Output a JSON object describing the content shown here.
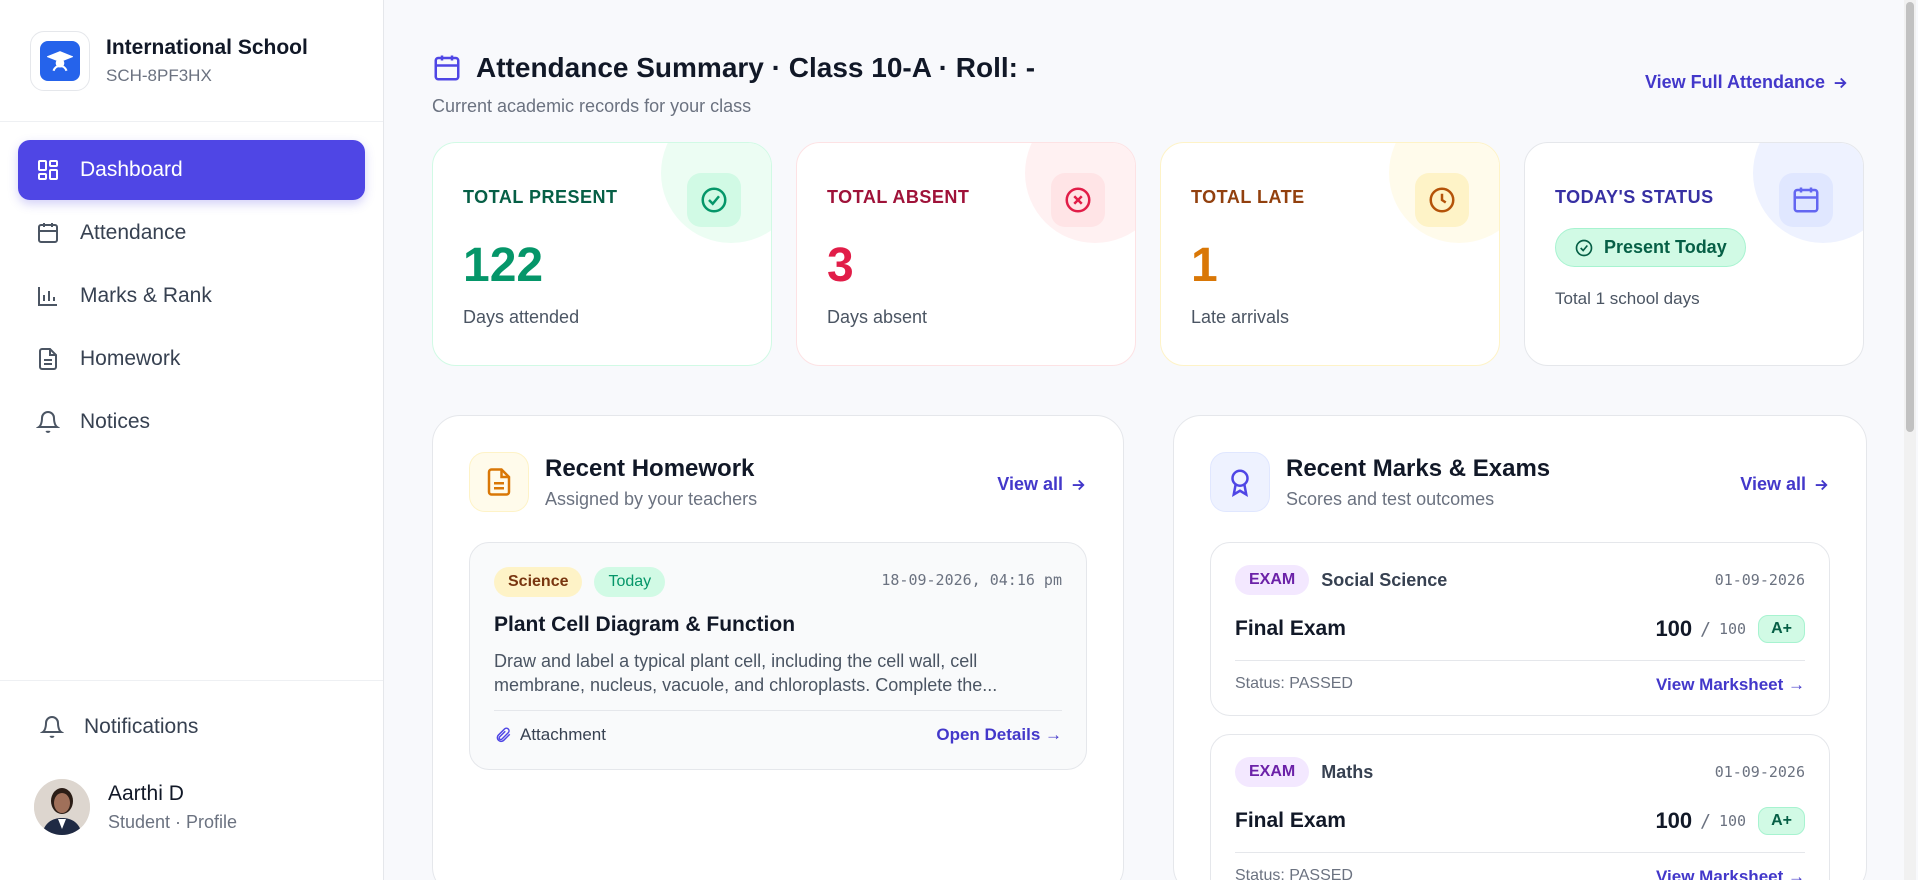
{
  "brand": {
    "name": "International School",
    "code": "SCH-8PF3HX"
  },
  "nav": [
    {
      "label": "Dashboard",
      "icon": "dashboard-icon",
      "active": true
    },
    {
      "label": "Attendance",
      "icon": "calendar-icon"
    },
    {
      "label": "Marks & Rank",
      "icon": "bar-chart-icon"
    },
    {
      "label": "Homework",
      "icon": "document-icon"
    },
    {
      "label": "Notices",
      "icon": "bell-icon"
    }
  ],
  "footer": {
    "notifications_label": "Notifications",
    "user_name": "Aarthi D",
    "user_sub": "Student · Profile"
  },
  "header": {
    "title": "Attendance Summary · Class 10-A · Roll: -",
    "subtitle": "Current academic records for your class",
    "view_full": "View Full Attendance"
  },
  "stats": {
    "present": {
      "label": "TOTAL PRESENT",
      "value": "122",
      "desc": "Days attended"
    },
    "absent": {
      "label": "TOTAL ABSENT",
      "value": "3",
      "desc": "Days absent"
    },
    "late": {
      "label": "TOTAL LATE",
      "value": "1",
      "desc": "Late arrivals"
    },
    "today": {
      "label": "TODAY'S STATUS",
      "status": "Present Today",
      "note": "Total 1 school days"
    }
  },
  "homework": {
    "title": "Recent Homework",
    "subtitle": "Assigned by your teachers",
    "view_all": "View all",
    "item": {
      "subject": "Science",
      "when": "Today",
      "date": "18-09-2026, 04:16 pm",
      "title": "Plant Cell Diagram & Function",
      "desc": "Draw and label a typical plant cell, including the cell wall, cell membrane, nucleus, vacuole, and chloroplasts. Complete the...",
      "attachment": "Attachment",
      "open": "Open Details →"
    }
  },
  "marks": {
    "title": "Recent Marks & Exams",
    "subtitle": "Scores and test outcomes",
    "view_all": "View all",
    "items": [
      {
        "tag": "EXAM",
        "subject": "Social Science",
        "date": "01-09-2026",
        "name": "Final Exam",
        "score": "100",
        "slash": "/",
        "max": "100",
        "grade": "A+",
        "status": "Status: PASSED",
        "link": "View Marksheet →"
      },
      {
        "tag": "EXAM",
        "subject": "Maths",
        "date": "01-09-2026",
        "name": "Final Exam",
        "score": "100",
        "slash": "/",
        "max": "100",
        "grade": "A+",
        "status": "Status: PASSED",
        "link": "View Marksheet →"
      }
    ]
  },
  "colors": {
    "accent": "#4f46e5",
    "present": "#059669",
    "absent": "#e11d48",
    "late": "#d97706"
  }
}
